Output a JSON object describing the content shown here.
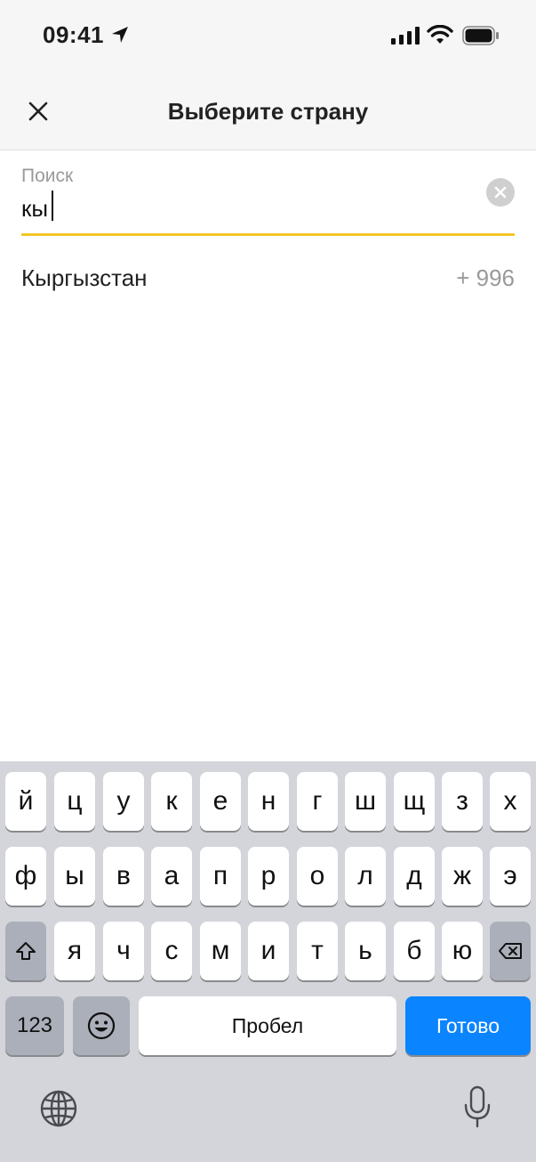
{
  "status_bar": {
    "time": "09:41",
    "icons": [
      "location-arrow-icon",
      "cellular-signal-icon",
      "wifi-icon",
      "battery-icon"
    ]
  },
  "header": {
    "title": "Выберите страну",
    "close_icon": "close-icon"
  },
  "search": {
    "label": "Поиск",
    "value": "кы",
    "clear_icon": "clear-circle-icon",
    "underline_color": "#f3c623"
  },
  "results": [
    {
      "name": "Кыргызстан",
      "code": "+ 996"
    }
  ],
  "keyboard": {
    "row1": [
      "й",
      "ц",
      "у",
      "к",
      "е",
      "н",
      "г",
      "ш",
      "щ",
      "з",
      "х"
    ],
    "row2": [
      "ф",
      "ы",
      "в",
      "а",
      "п",
      "р",
      "о",
      "л",
      "д",
      "ж",
      "э"
    ],
    "row3": [
      "я",
      "ч",
      "с",
      "м",
      "и",
      "т",
      "ь",
      "б",
      "ю"
    ],
    "numbers_key": "123",
    "space_key": "Пробел",
    "done_key": "Готово",
    "done_color": "#0a84ff",
    "icons": [
      "shift-icon",
      "backspace-icon",
      "emoji-icon",
      "globe-icon",
      "microphone-icon"
    ]
  }
}
